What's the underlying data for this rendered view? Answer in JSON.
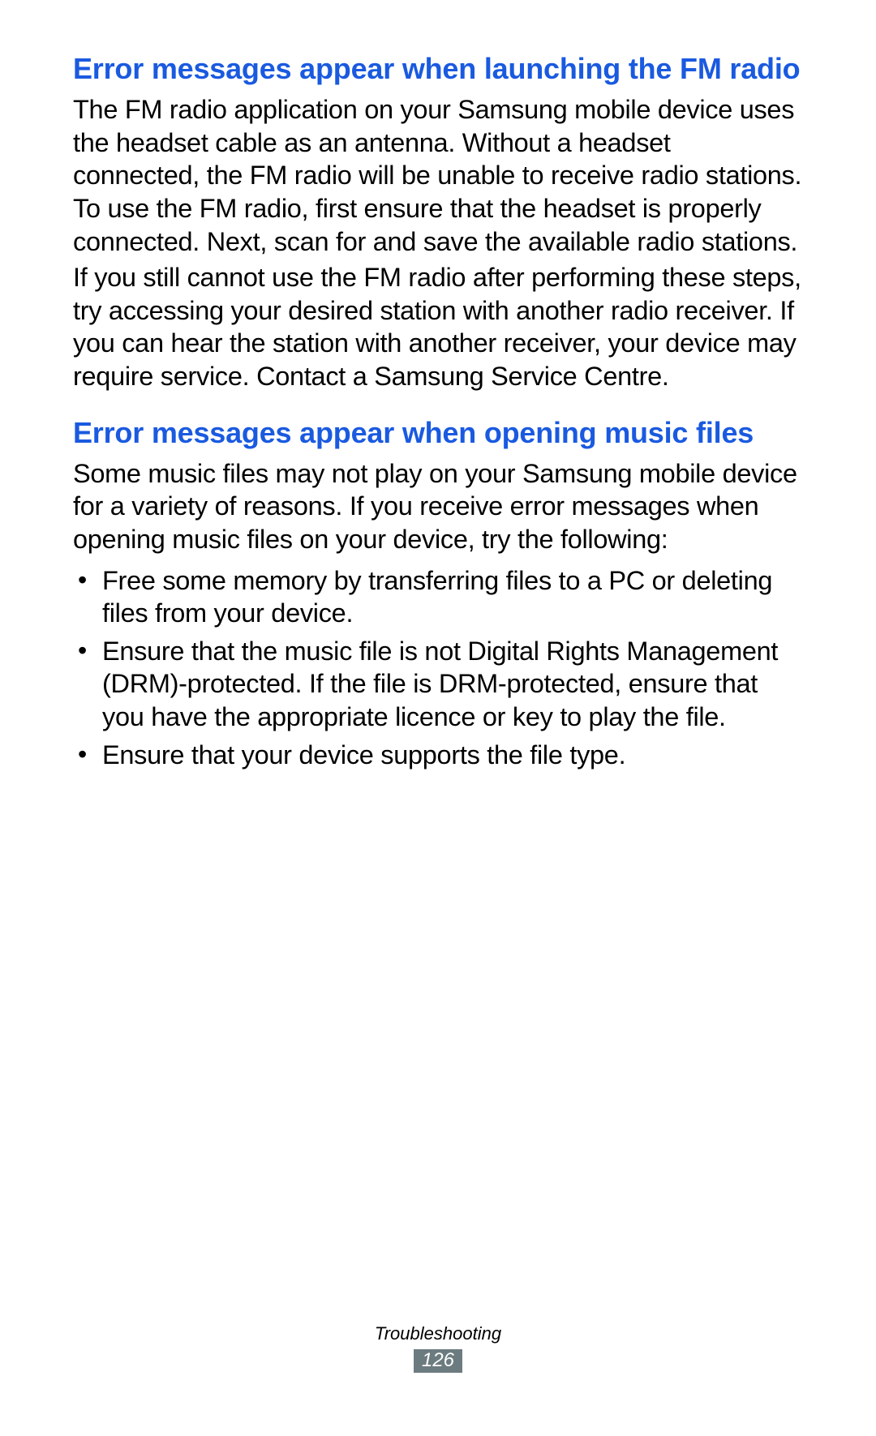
{
  "section1": {
    "heading": "Error messages appear when launching the FM radio",
    "p1": "The FM radio application on your Samsung mobile device uses the headset cable as an antenna. Without a headset connected, the FM radio will be unable to receive radio stations. To use the FM radio, first ensure that the headset is properly connected. Next, scan for and save the available radio stations.",
    "p2": "If you still cannot use the FM radio after performing these steps, try accessing your desired station with another radio receiver. If you can hear the station with another receiver, your device may require service. Contact a Samsung Service Centre."
  },
  "section2": {
    "heading": "Error messages appear when opening music files",
    "p1": "Some music files may not play on your Samsung mobile device for a variety of reasons. If you receive error messages when opening music files on your device, try the following:",
    "bullets": [
      "Free some memory by transferring files to a PC or deleting files from your device.",
      "Ensure that the music file is not Digital Rights Management (DRM)-protected. If the file is DRM-protected, ensure that you have the appropriate licence or key to play the file.",
      "Ensure that your device supports the file type."
    ]
  },
  "footer": {
    "label": "Troubleshooting",
    "page": "126"
  }
}
